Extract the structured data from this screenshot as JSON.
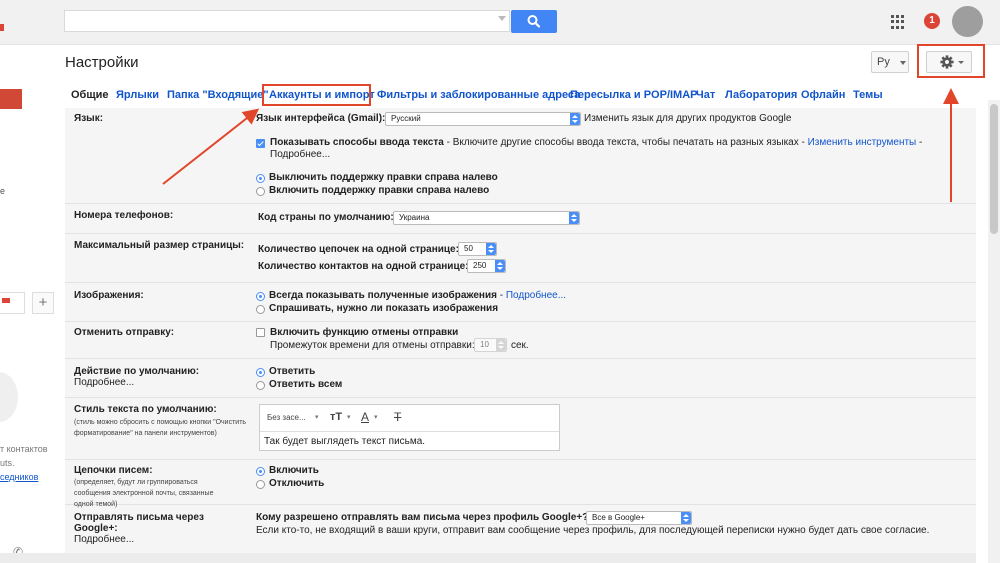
{
  "search": {
    "placeholder": ""
  },
  "header": {
    "notification_count": "1",
    "title": "Настройки",
    "lang_button": "Ру"
  },
  "left_nav": {
    "letter": "е",
    "contacts_line1": "т контактов",
    "contacts_line2": "uts.",
    "contacts_link": "седников"
  },
  "tabs": [
    {
      "label": "Общие",
      "active": true
    },
    {
      "label": "Ярлыки"
    },
    {
      "label": "Папка \"Входящие\""
    },
    {
      "label": "Аккаунты и импорт"
    },
    {
      "label": "Фильтры и заблокированные адреса"
    },
    {
      "label": "Пересылка и POP/IMAP"
    },
    {
      "label": "Чат"
    },
    {
      "label": "Лаборатория"
    },
    {
      "label": "Офлайн"
    },
    {
      "label": "Темы"
    }
  ],
  "settings": {
    "language": {
      "label": "Язык:",
      "interface_label": "Язык интерфейса (Gmail):",
      "interface_value": "Русский",
      "change_link": "Изменить язык для других продуктов Google",
      "input_methods_bold": "Показывать способы ввода текста",
      "input_methods_rest": " - Включите другие способы ввода текста, чтобы печатать на разных языках - ",
      "change_tools_link": "Изменить инструменты",
      "dash": " -",
      "more_link": "Подробнее...",
      "rtl_off": "Выключить поддержку правки справа налево",
      "rtl_on": "Включить поддержку правки справа налево"
    },
    "phone": {
      "label": "Номера телефонов:",
      "country_label": "Код страны по умолчанию:",
      "country_value": "Украина"
    },
    "page_size": {
      "label": "Максимальный размер страницы:",
      "threads_label": "Количество цепочек на одной странице:",
      "threads_value": "50",
      "contacts_label": "Количество контактов на одной странице:",
      "contacts_value": "250"
    },
    "images": {
      "label": "Изображения:",
      "always": "Всегда показывать полученные изображения",
      "always_dash": " - ",
      "more_link": "Подробнее...",
      "ask": "Спрашивать, нужно ли показать изображения"
    },
    "undo": {
      "label": "Отменить отправку:",
      "enable": "Включить функцию отмены отправки",
      "period_label": "Промежуток времени для отмены отправки:",
      "period_value": "10",
      "unit": "сек."
    },
    "default_reply": {
      "label": "Действие по умолчанию:",
      "more_link": "Подробнее...",
      "reply": "Ответить",
      "reply_all": "Ответить всем"
    },
    "text_style": {
      "label": "Стиль текста по умолчанию:",
      "sub": "(стиль можно сбросить с помощью кнопки \"Очистить форматирование\" на панели инструментов)",
      "font": "Без засе...",
      "preview": "Так будет выглядеть текст письма."
    },
    "threads": {
      "label": "Цепочки писем:",
      "sub": "(определяет, будут ли группироваться сообщения электронной почты, связанные одной темой)",
      "on": "Включить",
      "off": "Отключить"
    },
    "google_plus": {
      "label_line1": "Отправлять письма через",
      "label_line2": "Google+:",
      "more_link": "Подробнее...",
      "question": "Кому разрешено отправлять вам письма через профиль Google+?",
      "value": "Все в Google+",
      "note": "Если кто-то, не входящий в ваши круги, отправит вам сообщение через профиль, для последующей переписки нужно будет дать свое согласие."
    }
  },
  "colors": {
    "accent_blue": "#4285f4",
    "link": "#1155cc",
    "highlight_red": "#e2462a"
  }
}
